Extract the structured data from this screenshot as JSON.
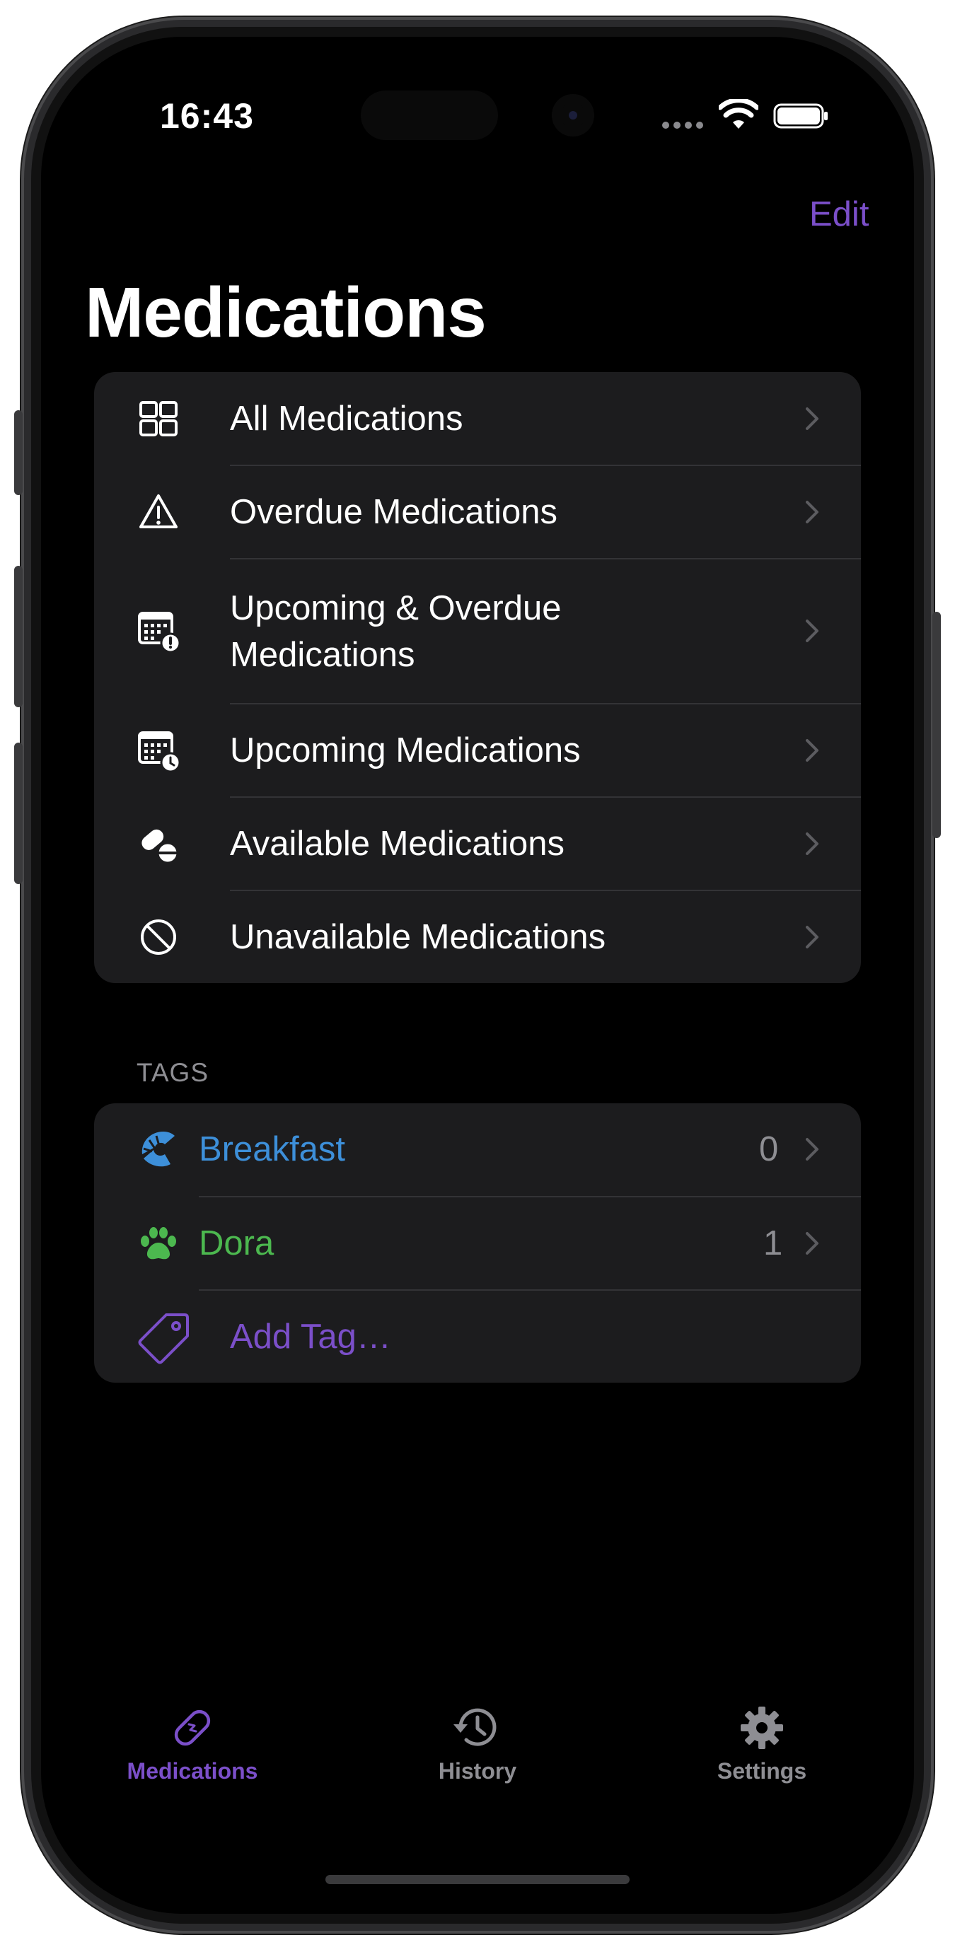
{
  "status_bar": {
    "time": "16:43"
  },
  "nav": {
    "edit_label": "Edit",
    "title": "Medications"
  },
  "lists": [
    {
      "label": "All Medications",
      "icon": "grid-icon"
    },
    {
      "label": "Overdue Medications",
      "icon": "warning-triangle-icon"
    },
    {
      "label": "Upcoming & Overdue",
      "label_line2": "Medications",
      "icon": "calendar-alert-icon"
    },
    {
      "label": "Upcoming Medications",
      "icon": "calendar-clock-icon"
    },
    {
      "label": "Available Medications",
      "icon": "pills-icon"
    },
    {
      "label": "Unavailable Medications",
      "icon": "prohibited-icon"
    }
  ],
  "tags": {
    "header": "TAGS",
    "items": [
      {
        "label": "Breakfast",
        "count": "0",
        "color": "#3d8fd9",
        "icon": "croissant-icon"
      },
      {
        "label": "Dora",
        "count": "1",
        "color": "#4cb84f",
        "icon": "paw-icon"
      }
    ],
    "add_label": "Add Tag…",
    "add_color": "#7b4fc9"
  },
  "tab_bar": {
    "tabs": [
      {
        "label": "Medications",
        "icon": "pill-icon",
        "active": true
      },
      {
        "label": "History",
        "icon": "clock-history-icon",
        "active": false
      },
      {
        "label": "Settings",
        "icon": "gear-icon",
        "active": false
      }
    ],
    "active_color": "#7b4fc9",
    "inactive_color": "#8e8e93"
  },
  "colors": {
    "accent": "#7b4fc9",
    "background": "#000000",
    "card": "#1c1c1e"
  }
}
